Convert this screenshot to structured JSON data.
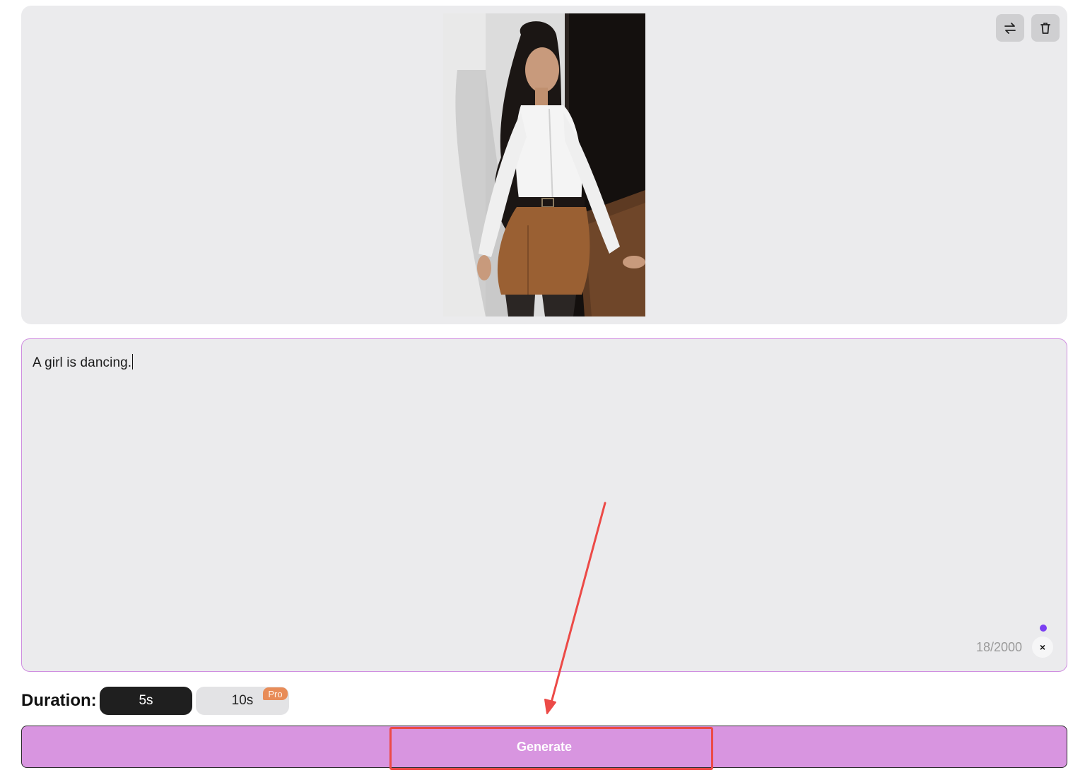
{
  "preview": {
    "image_alt": "Uploaded photo of a woman in a white shirt and brown skirt",
    "swap_icon": "swap-arrows-icon",
    "delete_icon": "trash-icon"
  },
  "prompt": {
    "value": "A girl is dancing.",
    "char_count": "18/2000",
    "clear_label": "×"
  },
  "duration": {
    "label": "Duration:",
    "options": [
      {
        "label": "5s",
        "selected": true
      },
      {
        "label": "10s",
        "selected": false,
        "badge": "Pro"
      }
    ]
  },
  "generate": {
    "label": "Generate"
  },
  "colors": {
    "accent": "#d895e0",
    "annotation": "#ec4a47",
    "pro_badge": "#e88c58",
    "dot": "#7b3ff2"
  }
}
